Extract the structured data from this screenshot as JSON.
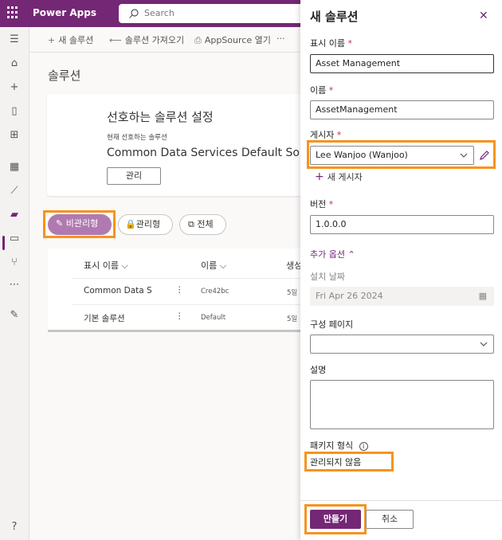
{
  "app": {
    "title": "Power Apps"
  },
  "search": {
    "placeholder": "Search"
  },
  "commands": {
    "new_solution": "새 솔루션",
    "import_solution": "솔루션 가져오기",
    "appsource": "AppSource 열기",
    "more": "···"
  },
  "page": {
    "title": "솔루션"
  },
  "preferred_card": {
    "title": "선호하는 솔루션 설정",
    "subtitle": "현재 선호하는 솔루션",
    "solution_name": "Common Data Services Default Solu",
    "manage_button": "관리"
  },
  "filters": {
    "unmanaged": "비관리형",
    "managed": "관리형",
    "all": "전체"
  },
  "table": {
    "headers": {
      "display_name": "표시 이름",
      "name": "이름",
      "created": "생성"
    },
    "rows": [
      {
        "display_name": "Common Data S",
        "name": "Cre42bc",
        "created": "5일"
      },
      {
        "display_name": "기본 솔루션",
        "name": "Default",
        "created": "5일"
      }
    ]
  },
  "panel": {
    "title": "새 솔루션",
    "display_name_label": "표시 이름",
    "display_name_value": "Asset Management",
    "name_label": "이름",
    "name_value": "AssetManagement",
    "publisher_label": "게시자",
    "publisher_value": "Lee Wanjoo (Wanjoo)",
    "new_publisher": "새 게시자",
    "version_label": "버전",
    "version_value": "1.0.0.0",
    "more_options": "추가 옵션",
    "install_date_label": "설치 날짜",
    "install_date_value": "Fri Apr 26 2024",
    "config_page_label": "구성 페이지",
    "description_label": "설명",
    "package_type_label": "패키지 형식",
    "package_type_value": "관리되지 않음",
    "create_button": "만들기",
    "cancel_button": "취소"
  },
  "colors": {
    "brand": "#742774",
    "highlight": "#f7931d"
  }
}
